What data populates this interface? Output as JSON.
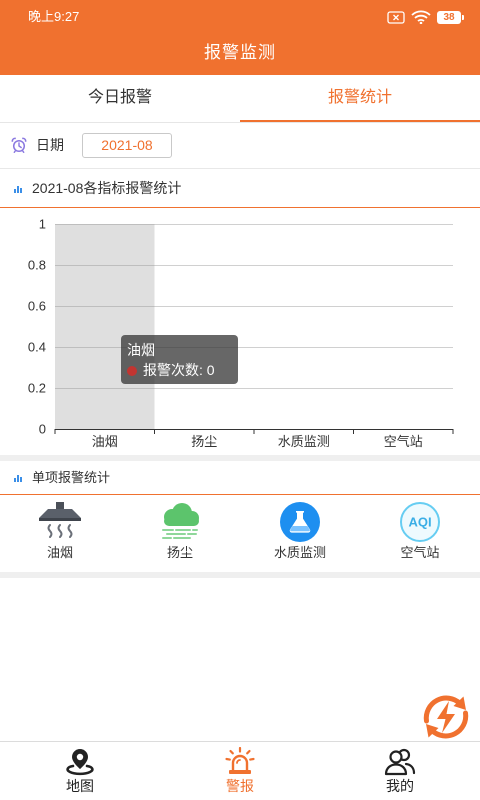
{
  "status_bar": {
    "time": "晚上9:27",
    "battery": "38",
    "icons": [
      "no-sim-icon",
      "wifi-icon",
      "battery-icon"
    ]
  },
  "header": {
    "title": "报警监测"
  },
  "tabs": [
    {
      "label": "今日报警",
      "active": false
    },
    {
      "label": "报警统计",
      "active": true
    }
  ],
  "date_filter": {
    "label": "日期",
    "value": "2021-08",
    "icon": "alarm-clock-icon"
  },
  "chart_data": {
    "type": "bar",
    "title": "2021-08各指标报警统计",
    "categories": [
      "油烟",
      "扬尘",
      "水质监测",
      "空气站"
    ],
    "series": [
      {
        "name": "报警次数",
        "values": [
          0,
          0,
          0,
          0
        ],
        "color": "#c23531"
      }
    ],
    "ylim": [
      0,
      1
    ],
    "yticks": [
      0,
      0.2,
      0.4,
      0.6,
      0.8,
      1
    ],
    "grid": true,
    "tooltip": {
      "category": "油烟"
    }
  },
  "single_stats": {
    "title": "单项报警统计",
    "items": [
      {
        "label": "油烟",
        "icon": "range-hood-icon"
      },
      {
        "label": "扬尘",
        "icon": "dust-cloud-icon"
      },
      {
        "label": "水质监测",
        "icon": "flask-icon"
      },
      {
        "label": "空气站",
        "icon": "aqi-icon",
        "icon_text": "AQI"
      }
    ]
  },
  "fab": {
    "icon": "refresh-lightning-icon"
  },
  "bottom_nav": {
    "items": [
      {
        "label": "地图",
        "icon": "map-pin-icon",
        "active": false
      },
      {
        "label": "警报",
        "icon": "alarm-light-icon",
        "active": true
      },
      {
        "label": "我的",
        "icon": "users-icon",
        "active": false
      }
    ]
  },
  "colors": {
    "primary": "#F0712F",
    "section_icon": "#3b8fe8",
    "clock_icon": "#8a78e0"
  }
}
